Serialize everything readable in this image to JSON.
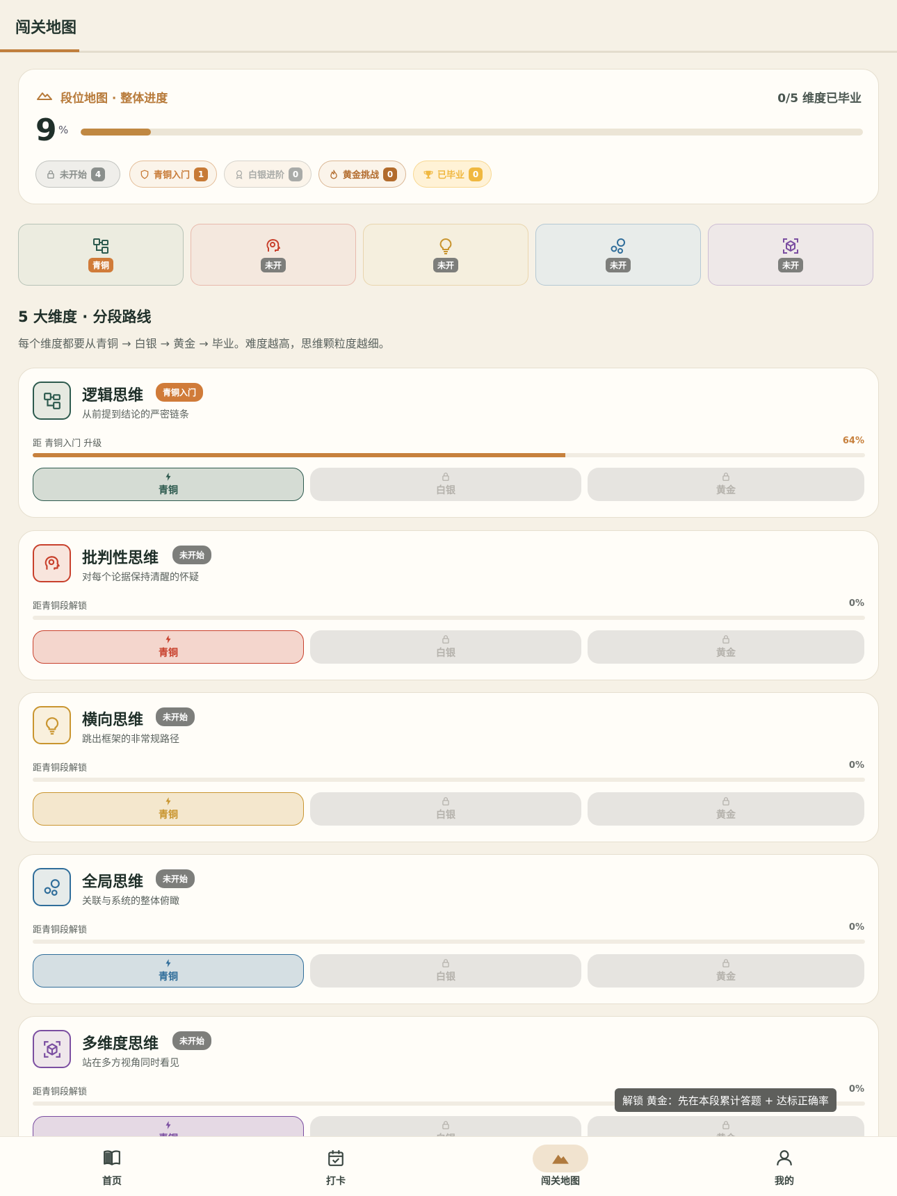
{
  "header": {
    "title": "闯关地图"
  },
  "overview": {
    "title": "段位地图 · 整体进度",
    "graduated": "0/5 维度已毕业",
    "percent": "9",
    "percent_unit": "%",
    "progress_fraction": 0.09,
    "chips": [
      {
        "label": "未开始",
        "count": "4",
        "icon": "lock-icon",
        "color": "#8a8f8c"
      },
      {
        "label": "青铜入门",
        "count": "1",
        "icon": "shield-icon",
        "color": "#c77a36"
      },
      {
        "label": "白银进阶",
        "count": "0",
        "icon": "medal-icon",
        "color": "#a9aba8"
      },
      {
        "label": "黄金挑战",
        "count": "0",
        "icon": "flame-icon",
        "color": "#b26b2c"
      },
      {
        "label": "已毕业",
        "count": "0",
        "icon": "trophy-icon",
        "color": "#f0b840"
      }
    ]
  },
  "tiles": [
    {
      "badge": "青铜",
      "icon": "logic-tree-icon",
      "accent": "#2d5a4e",
      "badge_color": "#d07b39"
    },
    {
      "badge": "未开",
      "icon": "brain-gear-icon",
      "accent": "#c8402c",
      "badge_color": "#7d7e7b"
    },
    {
      "badge": "未开",
      "icon": "lightbulb-icon",
      "accent": "#c9952f",
      "badge_color": "#7d7e7b"
    },
    {
      "badge": "未开",
      "icon": "network-icon",
      "accent": "#2f6d9a",
      "badge_color": "#7d7e7b"
    },
    {
      "badge": "未开",
      "icon": "cube-scan-icon",
      "accent": "#7b4ea1",
      "badge_color": "#7d7e7b"
    }
  ],
  "section": {
    "title": "5 大维度 · 分段路线",
    "subtitle": "每个维度都要从青铜 → 白银 → 黄金 → 毕业。难度越高，思维颗粒度越细。"
  },
  "dimensions": [
    {
      "name": "逻辑思维",
      "tag": "青铜入门",
      "desc": "从前提到结论的严密链条",
      "progress_label": "距 青铜入门 升级",
      "progress_text": "64%",
      "progress_fraction": 0.64,
      "accent": "#2d5a4e",
      "tag_color": "#d07b39",
      "icon": "logic-tree-icon",
      "tiers": [
        {
          "label": "青铜",
          "locked": false
        },
        {
          "label": "白银",
          "locked": true
        },
        {
          "label": "黄金",
          "locked": true
        }
      ]
    },
    {
      "name": "批判性思维",
      "tag": "未开始",
      "desc": "对每个论据保持清醒的怀疑",
      "progress_label": "距青铜段解锁",
      "progress_text": "0%",
      "progress_fraction": 0,
      "accent": "#c8402c",
      "tag_color": "#7d7e7b",
      "icon": "brain-gear-icon",
      "tiers": [
        {
          "label": "青铜",
          "locked": false
        },
        {
          "label": "白银",
          "locked": true
        },
        {
          "label": "黄金",
          "locked": true
        }
      ]
    },
    {
      "name": "横向思维",
      "tag": "未开始",
      "desc": "跳出框架的非常规路径",
      "progress_label": "距青铜段解锁",
      "progress_text": "0%",
      "progress_fraction": 0,
      "accent": "#c9952f",
      "tag_color": "#7d7e7b",
      "icon": "lightbulb-icon",
      "tiers": [
        {
          "label": "青铜",
          "locked": false
        },
        {
          "label": "白银",
          "locked": true
        },
        {
          "label": "黄金",
          "locked": true
        }
      ]
    },
    {
      "name": "全局思维",
      "tag": "未开始",
      "desc": "关联与系统的整体俯瞰",
      "progress_label": "距青铜段解锁",
      "progress_text": "0%",
      "progress_fraction": 0,
      "accent": "#2f6d9a",
      "tag_color": "#7d7e7b",
      "icon": "network-icon",
      "tiers": [
        {
          "label": "青铜",
          "locked": false
        },
        {
          "label": "白银",
          "locked": true
        },
        {
          "label": "黄金",
          "locked": true
        }
      ]
    },
    {
      "name": "多维度思维",
      "tag": "未开始",
      "desc": "站在多方视角同时看见",
      "progress_label": "距青铜段解锁",
      "progress_text": "0%",
      "progress_fraction": 0,
      "accent": "#7b4ea1",
      "tag_color": "#7d7e7b",
      "icon": "cube-scan-icon",
      "tiers": [
        {
          "label": "青铜",
          "locked": false
        },
        {
          "label": "白银",
          "locked": true
        },
        {
          "label": "黄金",
          "locked": true
        }
      ]
    }
  ],
  "tooltip": "解锁 黄金：先在本段累计答题 + 达标正确率",
  "nav": [
    {
      "label": "首页",
      "icon": "book-icon"
    },
    {
      "label": "打卡",
      "icon": "calendar-check-icon"
    },
    {
      "label": "闯关地图",
      "icon": "mountain-icon",
      "active": true
    },
    {
      "label": "我的",
      "icon": "user-icon"
    }
  ]
}
